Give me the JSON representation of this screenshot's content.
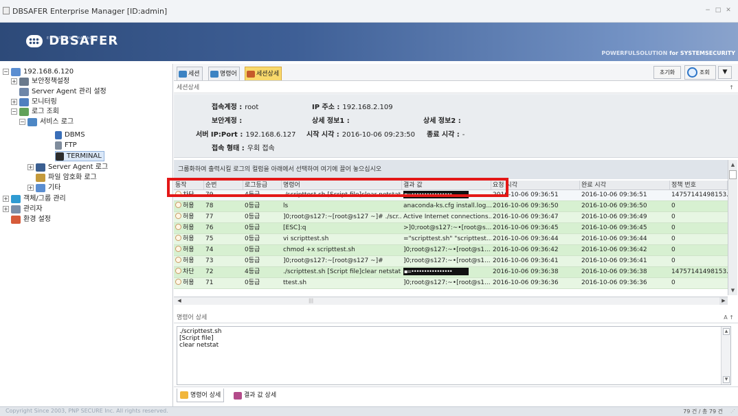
{
  "window": {
    "title": "DBSAFER Enterprise Manager [ID:admin]",
    "controls": [
      "−",
      "□",
      "✕"
    ]
  },
  "banner": {
    "brand": "DBSAFER",
    "sub": "ENTERPRISE MANAGER",
    "tagline_a": "POWERFULSOLUTION",
    "tagline_b": "for SYSTEMSECURITY"
  },
  "tree": [
    {
      "label": "192.168.6.120",
      "icon": "server-icon"
    },
    {
      "label": "보안정책설정",
      "icon": "policy-icon"
    },
    {
      "label": "Server Agent 관리 설정",
      "icon": "agent-icon"
    },
    {
      "label": "모니터링",
      "icon": "monitor-icon"
    },
    {
      "label": "로그 조회",
      "icon": "log-icon"
    },
    {
      "label": "서비스 로그",
      "icon": "service-log-icon"
    },
    {
      "label": "DBMS",
      "icon": "database-icon"
    },
    {
      "label": "FTP",
      "icon": "ftp-icon"
    },
    {
      "label": "TERMINAL",
      "icon": "terminal-icon"
    },
    {
      "label": "Server Agent 로그",
      "icon": "agent-log-icon"
    },
    {
      "label": "파일 암호화 로그",
      "icon": "file-encrypt-icon"
    },
    {
      "label": "기타",
      "icon": "etc-icon"
    },
    {
      "label": "객체/그룹 관리",
      "icon": "group-icon"
    },
    {
      "label": "관리자",
      "icon": "admin-icon"
    },
    {
      "label": "환경 설정",
      "icon": "settings-icon"
    }
  ],
  "tabs": [
    "세션",
    "명령어",
    "세션상세"
  ],
  "toolbar": {
    "reset": "초기화",
    "search": "조회",
    "dropdown": "▼"
  },
  "session": {
    "header": "세션상세",
    "pin": "↑",
    "fields": {
      "account_label": "접속계정 :",
      "account_value": "root",
      "ip_label": "IP 주소 :",
      "ip_value": "192.168.2.109",
      "sec_account_label": "보안계정 :",
      "detail1_label": "상세 정보1 :",
      "detail2_label": "상세 정보2 :",
      "server_label": "서버 IP:Port :",
      "server_value": "192.168.6.127",
      "start_label": "시작 시각 :",
      "start_value": "2016-10-06 09:23:50",
      "end_label": "종료 시각 :",
      "end_value": "-",
      "type_label": "접속 형태 :",
      "type_value": "우회 접속"
    }
  },
  "grid": {
    "group_hint": "그룹화하여 출력시킬 로그의 컬럼을 아래에서 선택하여 여기에 끌어 놓으십시오",
    "columns": [
      "동작",
      "순번",
      "로그등급",
      "명령어",
      "결과 값",
      "요청 시각",
      "완료 시각",
      "정책 번호"
    ],
    "rows": [
      {
        "action": "차단",
        "no": "79",
        "grade": "4등급",
        "cmd": "./scripttest.sh  [Script file]clear netstat",
        "result": "▪=••••••••••••••••",
        "req": "2016-10-06 09:36:51",
        "done": "2016-10-06 09:36:51",
        "policy": "14757141498153.",
        "masked": true
      },
      {
        "action": "허용",
        "no": "78",
        "grade": "0등급",
        "cmd": "ls",
        "result": "anaconda-ks.cfg  install.log...",
        "req": "2016-10-06 09:36:50",
        "done": "2016-10-06 09:36:50",
        "policy": "0",
        "masked": false
      },
      {
        "action": "허용",
        "no": "77",
        "grade": "0등급",
        "cmd": "]0;root@s127:~[root@s127 ~]# ./scr...",
        "result": "Active Internet connections...",
        "req": "2016-10-06 09:36:47",
        "done": "2016-10-06 09:36:49",
        "policy": "0",
        "masked": false
      },
      {
        "action": "허용",
        "no": "76",
        "grade": "0등급",
        "cmd": "[ESC]:q",
        "result": ">]0;root@s127:~•[root@s...",
        "req": "2016-10-06 09:36:45",
        "done": "2016-10-06 09:36:45",
        "policy": "0",
        "masked": false
      },
      {
        "action": "허용",
        "no": "75",
        "grade": "0등급",
        "cmd": "vi scripttest.sh",
        "result": "=\"scripttest.sh\" \"scripttest....",
        "req": "2016-10-06 09:36:44",
        "done": "2016-10-06 09:36:44",
        "policy": "0",
        "masked": false
      },
      {
        "action": "허용",
        "no": "74",
        "grade": "0등급",
        "cmd": "chmod +x scripttest.sh",
        "result": "]0;root@s127:~•[root@s1...",
        "req": "2016-10-06 09:36:42",
        "done": "2016-10-06 09:36:42",
        "policy": "0",
        "masked": false
      },
      {
        "action": "허용",
        "no": "73",
        "grade": "0등급",
        "cmd": "]0;root@s127:~[root@s127 ~]#",
        "result": "]0;root@s127:~•[root@s1...",
        "req": "2016-10-06 09:36:41",
        "done": "2016-10-06 09:36:41",
        "policy": "0",
        "masked": false
      },
      {
        "action": "차단",
        "no": "72",
        "grade": "4등급",
        "cmd": "./scripttest.sh  [Script file]clear netstat",
        "result": "▪=••••••••••••••••",
        "req": "2016-10-06 09:36:38",
        "done": "2016-10-06 09:36:38",
        "policy": "14757141498153.",
        "masked": true
      },
      {
        "action": "허용",
        "no": "71",
        "grade": "0등급",
        "cmd": "ttest.sh",
        "result": "]0;root@s127:~•[root@s1...",
        "req": "2016-10-06 09:36:36",
        "done": "2016-10-06 09:36:36",
        "policy": "0",
        "masked": false
      }
    ]
  },
  "command_detail": {
    "header": "명령어 상세",
    "pin": "A ↑",
    "text": "./scripttest.sh\n[Script file]\nclear netstat"
  },
  "bottom_tabs": [
    "명령어 상세",
    "결과 값 상세"
  ],
  "status": {
    "copyright": "Copyright Since 2003, PNP SECURE Inc. All rights reserved.",
    "count": "79 건 / 총 79 건"
  },
  "colors": {
    "banner": "#2d4a79",
    "highlight": "#e31717",
    "row_allow": "#d7f0d1",
    "active_tab": "#f9d96b"
  }
}
